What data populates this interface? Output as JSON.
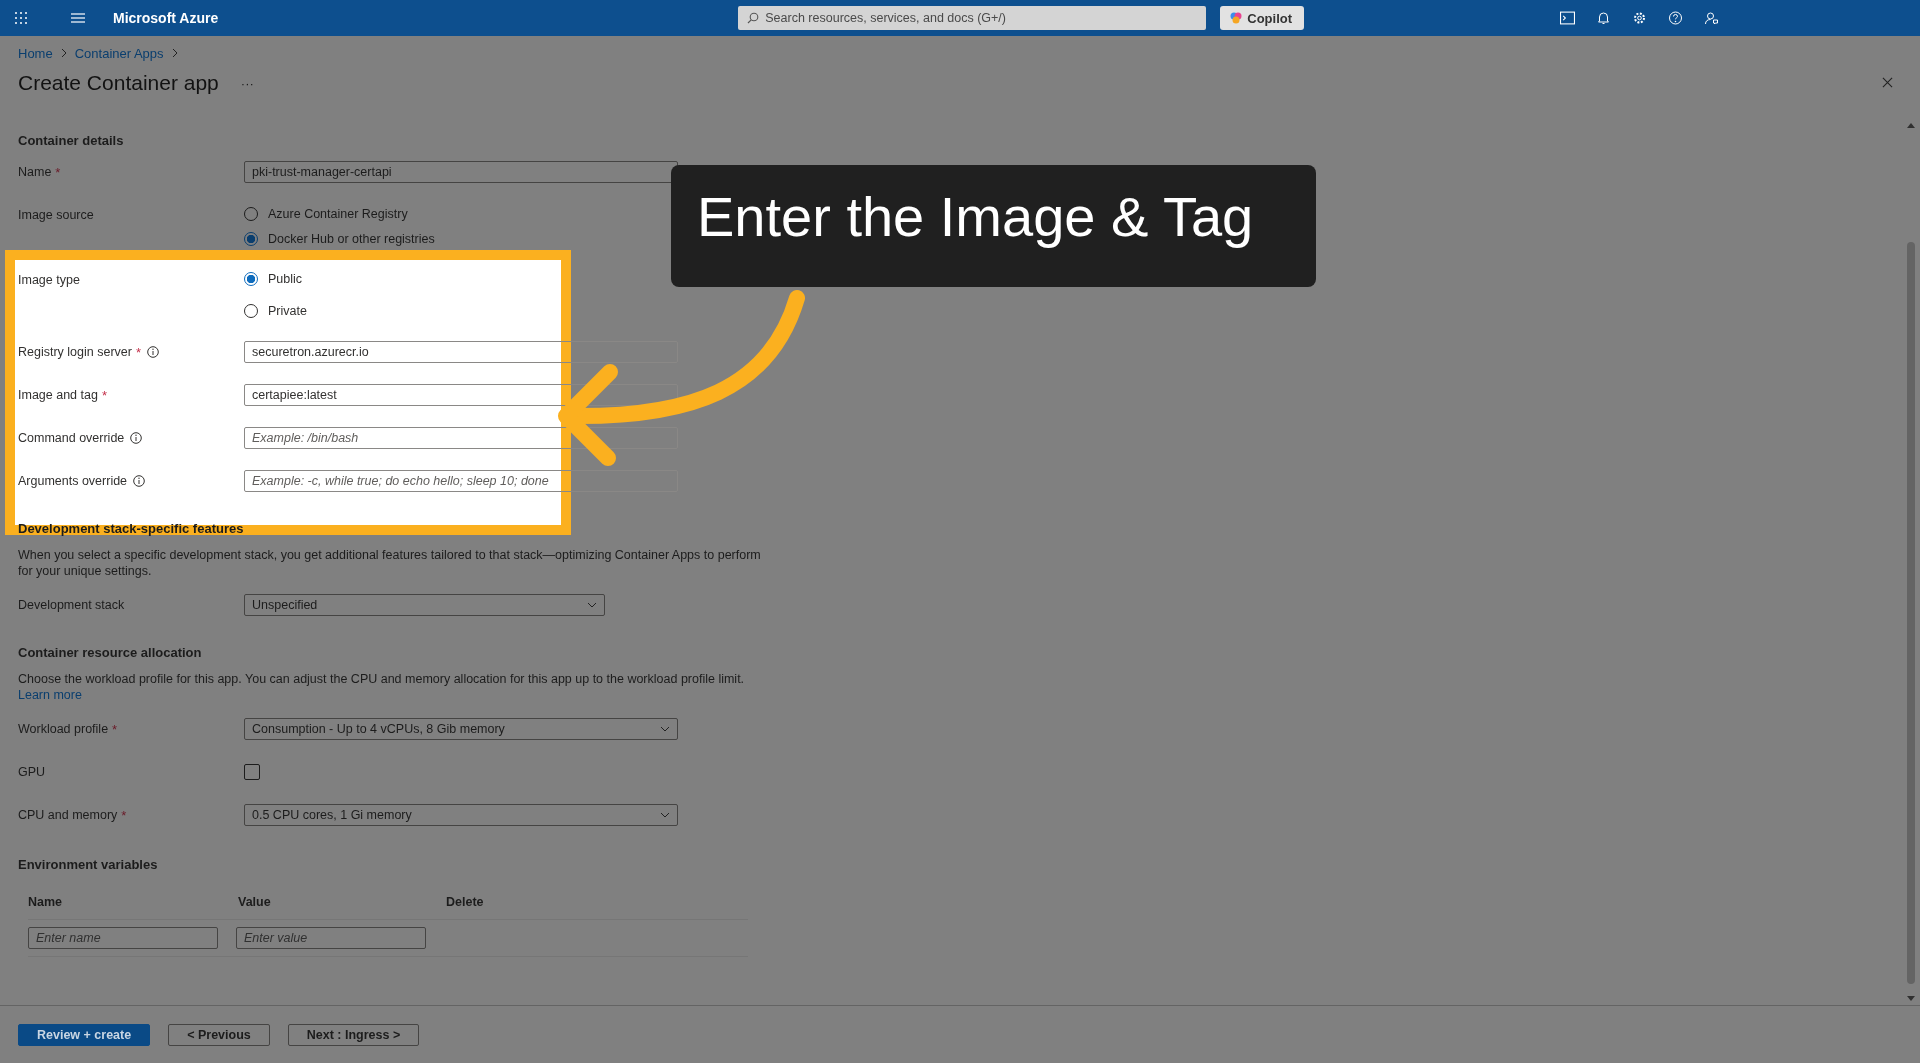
{
  "top_bar": {
    "brand": "Microsoft Azure",
    "search": {
      "placeholder": "Search resources, services, and docs (G+/)"
    },
    "copilot": "Copilot"
  },
  "breadcrumb": [
    "Home",
    "Container Apps"
  ],
  "page_title": "Create Container app",
  "more": "···",
  "required_mark": "*",
  "sections": [
    {
      "heading": "Container details",
      "rows": [
        {
          "kind": "text",
          "label": "Name",
          "required": true,
          "info": false,
          "value": "pki-trust-manager-certapi"
        },
        {
          "kind": "radio",
          "label": "Image source",
          "options": [
            {
              "label": "Azure Container Registry",
              "selected": false
            },
            {
              "label": "Docker Hub or other registries",
              "selected": true
            }
          ]
        },
        {
          "kind": "radio",
          "label": "Image type",
          "options": [
            {
              "label": "Public",
              "selected": true
            },
            {
              "label": "Private",
              "selected": false
            }
          ]
        },
        {
          "kind": "text",
          "label": "Registry login server",
          "required": true,
          "info": true,
          "value": "securetron.azurecr.io"
        },
        {
          "kind": "text",
          "label": "Image and tag",
          "required": true,
          "info": false,
          "value": "certapiee:latest"
        },
        {
          "kind": "text",
          "label": "Command override",
          "required": false,
          "info": true,
          "placeholder": "Example: /bin/bash"
        },
        {
          "kind": "text",
          "label": "Arguments override",
          "required": false,
          "info": true,
          "placeholder": "Example: -c, while true; do echo hello; sleep 10; done"
        }
      ]
    },
    {
      "heading": "Development stack-specific features",
      "description": "When you select a specific development stack, you get additional features tailored to that stack—optimizing Container Apps to perform for your unique settings.",
      "rows": [
        {
          "kind": "select",
          "label": "Development stack",
          "required": false,
          "value": "Unspecified"
        }
      ]
    },
    {
      "heading": "Container resource allocation",
      "description": "Choose the workload profile for this app. You can adjust the CPU and memory allocation for this app up to the workload profile limit.",
      "link": "Learn more",
      "rows": [
        {
          "kind": "select",
          "label": "Workload profile",
          "required": true,
          "value": "Consumption - Up to 4 vCPUs, 8 Gib memory"
        },
        {
          "kind": "checkbox",
          "label": "GPU",
          "required": false,
          "checked": false
        },
        {
          "kind": "select",
          "label": "CPU and memory",
          "required": true,
          "value": "0.5 CPU cores, 1 Gi memory"
        }
      ]
    }
  ],
  "environment_variables": {
    "heading": "Environment variables",
    "columns": [
      "Name",
      "Value",
      "Delete"
    ],
    "inputs": [
      {
        "placeholder": "Enter name"
      },
      {
        "placeholder": "Enter value"
      }
    ]
  },
  "footer_buttons": [
    {
      "label": "Review + create",
      "kind": "primary"
    },
    {
      "label": "< Previous",
      "kind": "secondary"
    },
    {
      "label": "Next : Ingress >",
      "kind": "secondary"
    }
  ],
  "tooltip": "Enter the Image & Tag"
}
